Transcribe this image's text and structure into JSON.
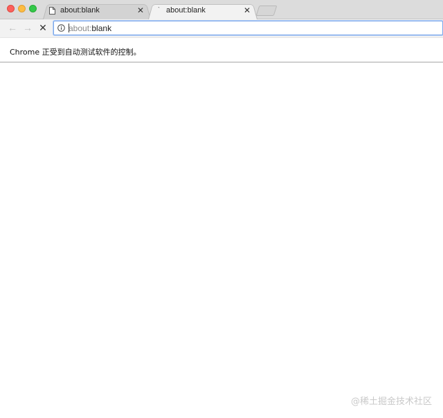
{
  "tabs": [
    {
      "title": "about:blank",
      "favicon": "document-icon",
      "state": "inactive"
    },
    {
      "title": "about:blank",
      "favicon": "loading-spinner-icon",
      "state": "active"
    }
  ],
  "toolbar": {
    "back_icon": "←",
    "forward_icon": "→",
    "stop_icon": "✕",
    "omnibox": {
      "scheme": "about:",
      "path": "blank",
      "icon": "info-icon"
    }
  },
  "infobar": {
    "message": "Chrome 正受到自动测试软件的控制。"
  },
  "watermark": "@稀土掘金技术社区",
  "colors": {
    "omnibox_focus": "#7aa7ea",
    "traffic_close": "#fc605c",
    "traffic_min": "#fdbc40",
    "traffic_max": "#34c84a"
  }
}
